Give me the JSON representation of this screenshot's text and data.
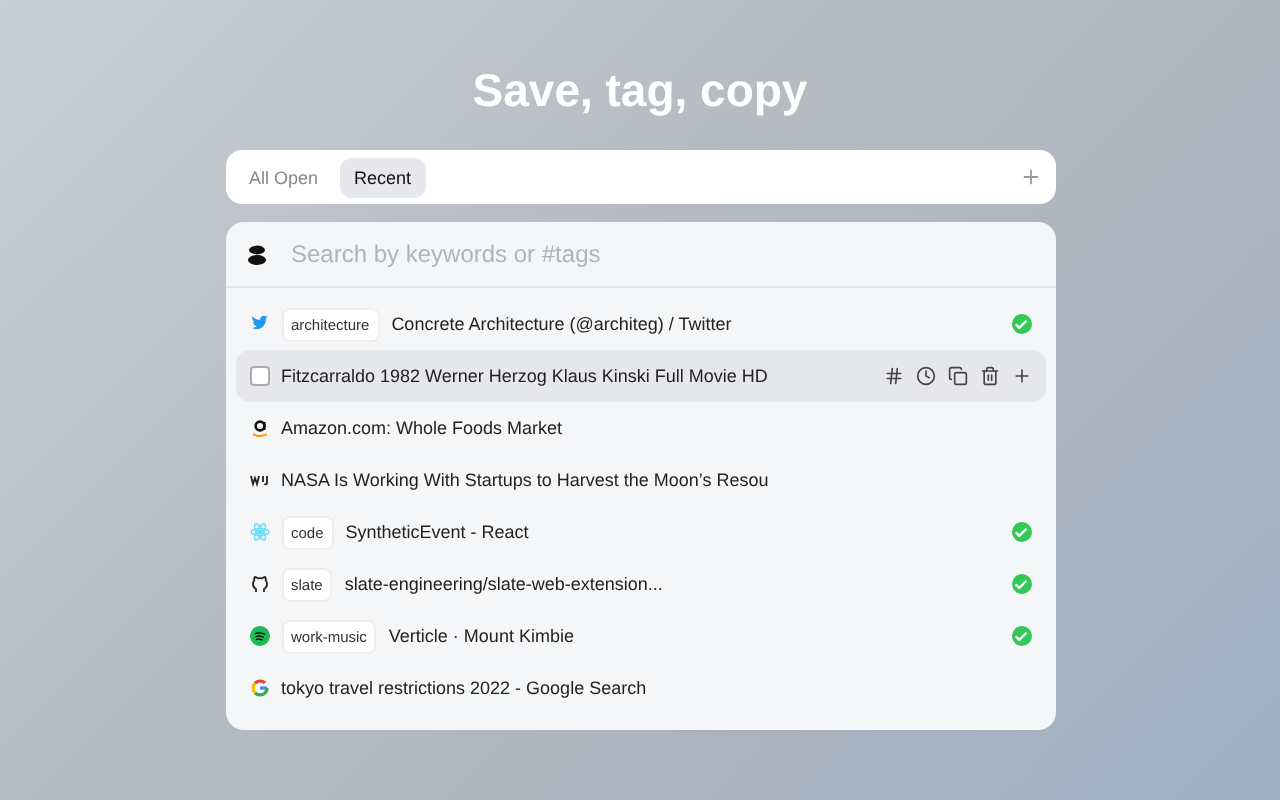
{
  "heading": "Save, tag, copy",
  "tabs": [
    {
      "label": "All Open",
      "selected": false
    },
    {
      "label": "Recent",
      "selected": true
    }
  ],
  "search": {
    "placeholder": "Search by keywords or #tags"
  },
  "rows": [
    {
      "kind": "twitter",
      "tag": "architecture",
      "title": "Concrete Architecture (@architeg) / Twitter",
      "saved": true,
      "selected": false
    },
    {
      "kind": "checkbox",
      "checked": false,
      "title": "Fitzcarraldo 1982 Werner Herzog Klaus Kinski Full Movie HD",
      "saved": false,
      "selected": true
    },
    {
      "kind": "amazon",
      "title": "Amazon.com: Whole Foods Market",
      "saved": false,
      "selected": false
    },
    {
      "kind": "wsj",
      "title": "NASA Is Working With Startups to Harvest the Moon’s Resou",
      "saved": false,
      "selected": false
    },
    {
      "kind": "react",
      "tag": "code",
      "title": "SyntheticEvent - React",
      "saved": true,
      "selected": false
    },
    {
      "kind": "github",
      "tag": "slate",
      "title": "slate-engineering/slate-web-extension...",
      "saved": true,
      "selected": false
    },
    {
      "kind": "spotify",
      "tag": "work-music",
      "title": "Verticle · Mount Kimbie",
      "saved": true,
      "selected": false
    },
    {
      "kind": "google",
      "title": "tokyo travel restrictions 2022 - Google Search",
      "saved": false,
      "selected": false
    }
  ]
}
